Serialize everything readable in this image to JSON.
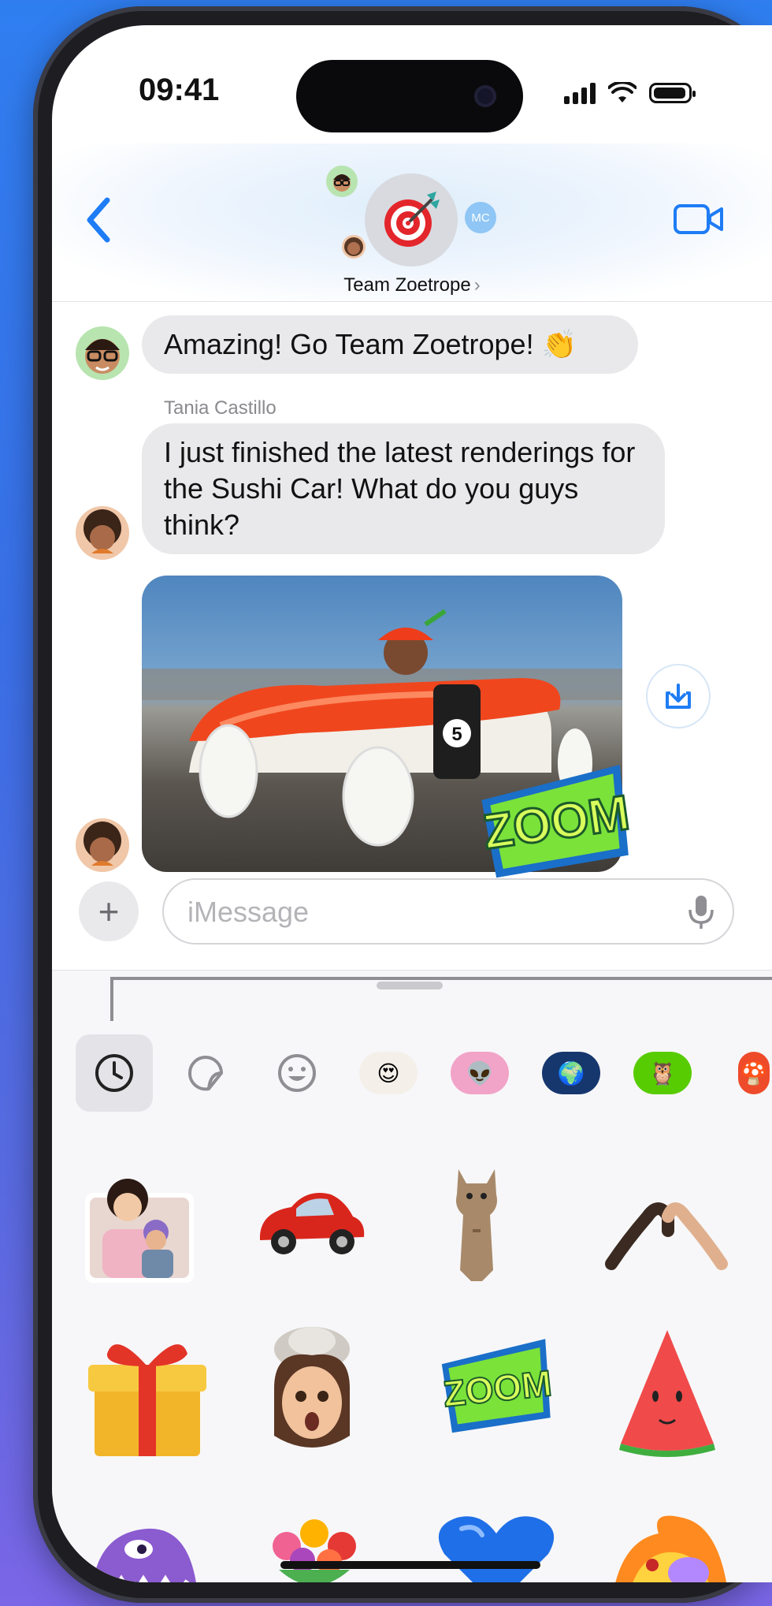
{
  "status_bar": {
    "time": "09:41",
    "icons": [
      "signal-icon",
      "wifi-icon",
      "battery-icon"
    ]
  },
  "header": {
    "back_icon": "chevron-left-icon",
    "group_name": "Team Zoetrope",
    "group_chevron": "›",
    "group_icon": "dart-target-icon",
    "member_initials": "MC",
    "video_icon": "video-camera-icon"
  },
  "messages": [
    {
      "sender": "",
      "text": "Amazing! Go Team Zoetrope! 👏"
    },
    {
      "sender": "Tania Castillo",
      "text": "I just finished the latest renderings for the Sushi Car! What do you guys think?"
    }
  ],
  "photo": {
    "car_number": "5",
    "sticker_text": "ZOOM",
    "save_icon": "download-tray-icon"
  },
  "composer": {
    "placeholder": "iMessage",
    "plus_label": "+",
    "mic_icon": "microphone-icon"
  },
  "sticker_tray": {
    "tabs": [
      "recents-clock-icon",
      "stickers-peel-icon",
      "emoji-smiley-icon",
      "memoji-icon",
      "app-pink-icon",
      "app-globe-icon",
      "app-duo-owl-icon",
      "app-red-icon"
    ]
  },
  "stickers": [
    "family-photo-sticker",
    "red-car-sticker",
    "kitten-sticker",
    "heart-hands-sticker",
    "gift-sticker",
    "mind-blown-memoji-sticker",
    "zoom-sticker",
    "watermelon-sticker",
    "monster-sticker",
    "flowers-sticker",
    "blue-heart-sticker",
    "fire-creature-sticker"
  ],
  "colors": {
    "accent": "#1e7cf5",
    "bubble": "#e9e9eb",
    "background": "#3a6fe6"
  }
}
